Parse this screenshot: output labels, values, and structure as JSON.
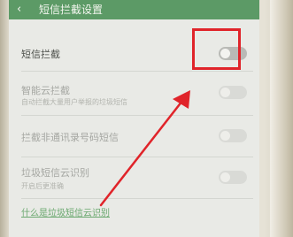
{
  "header": {
    "back_icon": "chevron-left-icon",
    "back_glyph": "‹",
    "title": "短信拦截设置"
  },
  "settings": [
    {
      "label": "短信拦截",
      "subtitle": "",
      "enabled": false
    },
    {
      "label": "智能云拦截",
      "subtitle": "自动拦截大量用户举报的垃圾短信",
      "enabled": false
    },
    {
      "label": "拦截非通讯录号码短信",
      "subtitle": "",
      "enabled": false
    },
    {
      "label": "垃圾短信云识别",
      "subtitle": "开启后更准确",
      "enabled": false
    }
  ],
  "link": {
    "label": "什么是垃圾短信云识别"
  },
  "annotation": {
    "color": "#e0242a"
  },
  "colors": {
    "titlebar": "#5c9a66",
    "link": "#6aa86f"
  }
}
